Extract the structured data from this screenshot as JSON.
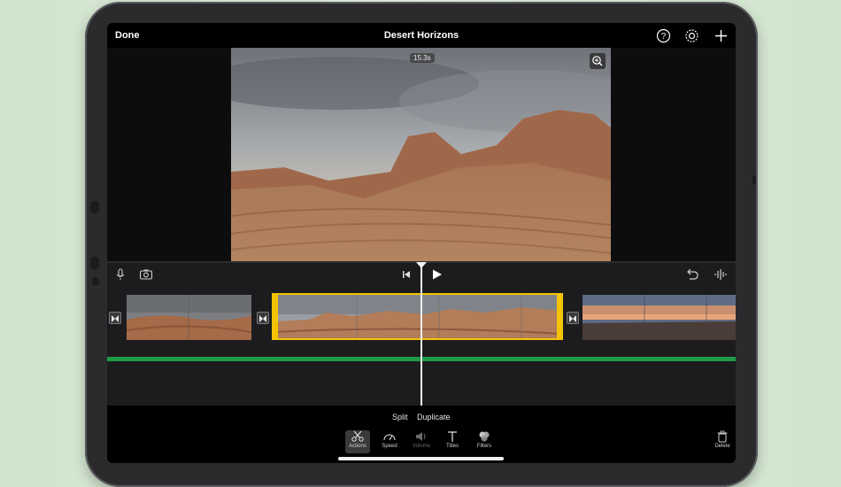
{
  "header": {
    "done_label": "Done",
    "project_title": "Desert Horizons",
    "help_icon": "question-circle-icon",
    "settings_icon": "gear-icon",
    "add_icon": "plus-icon"
  },
  "viewer": {
    "clip_duration": "15.3s",
    "zoom_icon": "magnifier-plus-icon"
  },
  "controls": {
    "microphone_icon": "microphone-icon",
    "camera_icon": "camera-icon",
    "skip_back_icon": "skip-to-start-icon",
    "play_icon": "play-icon",
    "undo_icon": "undo-icon",
    "audio_icon": "waveform-icon"
  },
  "inspector": {
    "actions": [
      "Split",
      "Duplicate"
    ],
    "tools": [
      {
        "label": "Actions",
        "icon": "scissors-icon"
      },
      {
        "label": "Speed",
        "icon": "speedometer-icon"
      },
      {
        "label": "Volume",
        "icon": "speaker-icon"
      },
      {
        "label": "Titles",
        "icon": "title-t-icon"
      },
      {
        "label": "Filters",
        "icon": "filters-circles-icon"
      }
    ],
    "delete_label": "Delete",
    "delete_icon": "trash-icon"
  },
  "colors": {
    "selection": "#f5c400",
    "audio_track": "#1d9b47",
    "background": "#d9e9d8"
  }
}
